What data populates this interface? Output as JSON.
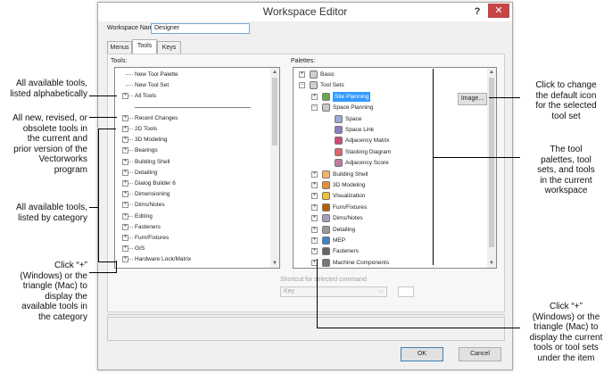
{
  "dialog": {
    "title": "Workspace Editor",
    "help_label": "?",
    "close_label": "✕",
    "workspace_name_label": "Workspace Name:",
    "workspace_name_value": "Designer",
    "tabs": [
      "Menus",
      "Tools",
      "Keys"
    ],
    "active_tab": "Tools",
    "tools_label": "Tools:",
    "palettes_label": "Palettes:",
    "image_button": "Image...",
    "shortcut_label": "Shortcut for selected command",
    "key_select_value": "Key",
    "ok_button": "OK",
    "cancel_button": "Cancel"
  },
  "tools_tree": [
    {
      "label": "New Tool Palette",
      "expander": false
    },
    {
      "label": "New Tool Set",
      "expander": false
    },
    {
      "label": "All Tools",
      "expander": true
    },
    {
      "label": "",
      "separator": true
    },
    {
      "label": "Recent Changes",
      "expander": true
    },
    {
      "label": "2D Tools",
      "expander": true
    },
    {
      "label": "3D Modeling",
      "expander": true
    },
    {
      "label": "Bearings",
      "expander": true
    },
    {
      "label": "Building Shell",
      "expander": true
    },
    {
      "label": "Detailing",
      "expander": true
    },
    {
      "label": "Dialog Builder 6",
      "expander": true
    },
    {
      "label": "Dimensioning",
      "expander": true
    },
    {
      "label": "Dims/Notes",
      "expander": true
    },
    {
      "label": "Editing",
      "expander": true
    },
    {
      "label": "Fasteners",
      "expander": true
    },
    {
      "label": "Furn/Fixtures",
      "expander": true
    },
    {
      "label": "GIS",
      "expander": true
    },
    {
      "label": "Hardware Lock/Matrix",
      "expander": true
    }
  ],
  "palettes_tree": [
    {
      "label": "Basic",
      "level": 0,
      "expander": "+",
      "icon": "palette-icon"
    },
    {
      "label": "Tool Sets",
      "level": 0,
      "expander": "−",
      "icon": "palette-icon"
    },
    {
      "label": "Site Planning",
      "level": 1,
      "expander": "+",
      "icon": "site-icon",
      "selected": true
    },
    {
      "label": "Space Planning",
      "level": 1,
      "expander": "−",
      "icon": "space-planning-icon"
    },
    {
      "label": "Space",
      "level": 2,
      "icon": "space-icon"
    },
    {
      "label": "Space Link",
      "level": 2,
      "icon": "space-link-icon"
    },
    {
      "label": "Adjacency Matrix",
      "level": 2,
      "icon": "matrix-icon"
    },
    {
      "label": "Stacking Diagram",
      "level": 2,
      "icon": "stacking-icon"
    },
    {
      "label": "Adjacency Score",
      "level": 2,
      "icon": "score-icon"
    },
    {
      "label": "Building Shell",
      "level": 1,
      "expander": "+",
      "icon": "building-icon"
    },
    {
      "label": "3D Modeling",
      "level": 1,
      "expander": "+",
      "icon": "modeling-icon"
    },
    {
      "label": "Visualization",
      "level": 1,
      "expander": "+",
      "icon": "visualization-icon"
    },
    {
      "label": "Furn/Fixtures",
      "level": 1,
      "expander": "+",
      "icon": "furniture-icon"
    },
    {
      "label": "Dims/Notes",
      "level": 1,
      "expander": "+",
      "icon": "dims-icon"
    },
    {
      "label": "Detailing",
      "level": 1,
      "expander": "+",
      "icon": "detailing-icon"
    },
    {
      "label": "MEP",
      "level": 1,
      "expander": "+",
      "icon": "mep-icon"
    },
    {
      "label": "Fasteners",
      "level": 1,
      "expander": "+",
      "icon": "fasteners-icon"
    },
    {
      "label": "Machine Components",
      "level": 1,
      "expander": "+",
      "icon": "machine-icon"
    }
  ],
  "callouts": {
    "all_tools": "All available tools,\nlisted alphabetically",
    "recent": "All new, revised, or\nobsolete tools in\nthe current and\nprior version of the\nVectorworks\nprogram",
    "category": "All available tools,\nlisted by category",
    "click_plus_left": "Click “+”\n(Windows) or the\ntriangle (Mac) to\ndisplay the\navailable tools in\nthe category",
    "change_icon": "Click to change\nthe default icon\nfor the selected\ntool set",
    "palettes_desc": "The tool\npalettes, tool\nsets, and tools\nin the current\nworkspace",
    "click_plus_right": "Click “+”\n(Windows) or the\ntriangle (Mac) to\ndisplay the current\ntools or tool sets\nunder the item"
  }
}
